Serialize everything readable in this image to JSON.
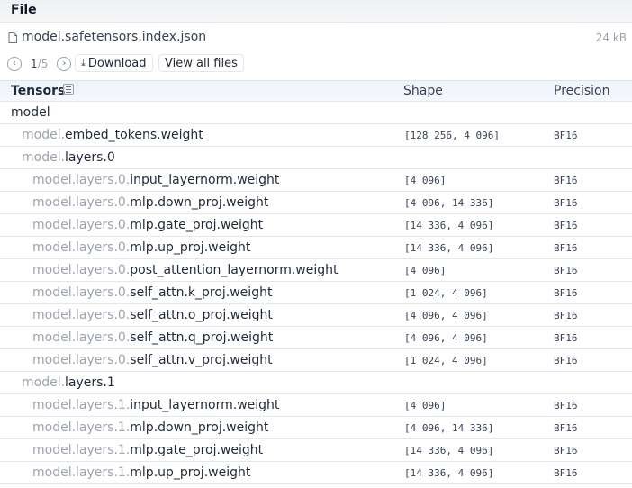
{
  "topbar": {
    "title": "File"
  },
  "file": {
    "name": "model.safetensors.index.json",
    "size": "24 kB",
    "page": "1",
    "page_sep": "/",
    "page_total": "5",
    "download_label": "Download",
    "view_all_label": "View all files"
  },
  "table": {
    "headers": {
      "tensors": "Tensors",
      "shape": "Shape",
      "precision": "Precision"
    },
    "rows": [
      {
        "kind": "group",
        "level": 0,
        "prefix": "",
        "suffix": "model"
      },
      {
        "kind": "tensor",
        "level": 1,
        "prefix": "model.",
        "suffix": "embed_tokens.weight",
        "shape": "[128 256, 4 096]",
        "precision": "BF16"
      },
      {
        "kind": "group",
        "level": 1,
        "prefix": "model.",
        "suffix": "layers.0"
      },
      {
        "kind": "tensor",
        "level": 2,
        "prefix": "model.layers.0.",
        "suffix": "input_layernorm.weight",
        "shape": "[4 096]",
        "precision": "BF16"
      },
      {
        "kind": "tensor",
        "level": 2,
        "prefix": "model.layers.0.",
        "suffix": "mlp.down_proj.weight",
        "shape": "[4 096, 14 336]",
        "precision": "BF16"
      },
      {
        "kind": "tensor",
        "level": 2,
        "prefix": "model.layers.0.",
        "suffix": "mlp.gate_proj.weight",
        "shape": "[14 336, 4 096]",
        "precision": "BF16"
      },
      {
        "kind": "tensor",
        "level": 2,
        "prefix": "model.layers.0.",
        "suffix": "mlp.up_proj.weight",
        "shape": "[14 336, 4 096]",
        "precision": "BF16"
      },
      {
        "kind": "tensor",
        "level": 2,
        "prefix": "model.layers.0.",
        "suffix": "post_attention_layernorm.weight",
        "shape": "[4 096]",
        "precision": "BF16"
      },
      {
        "kind": "tensor",
        "level": 2,
        "prefix": "model.layers.0.",
        "suffix": "self_attn.k_proj.weight",
        "shape": "[1 024, 4 096]",
        "precision": "BF16"
      },
      {
        "kind": "tensor",
        "level": 2,
        "prefix": "model.layers.0.",
        "suffix": "self_attn.o_proj.weight",
        "shape": "[4 096, 4 096]",
        "precision": "BF16"
      },
      {
        "kind": "tensor",
        "level": 2,
        "prefix": "model.layers.0.",
        "suffix": "self_attn.q_proj.weight",
        "shape": "[4 096, 4 096]",
        "precision": "BF16"
      },
      {
        "kind": "tensor",
        "level": 2,
        "prefix": "model.layers.0.",
        "suffix": "self_attn.v_proj.weight",
        "shape": "[1 024, 4 096]",
        "precision": "BF16"
      },
      {
        "kind": "group",
        "level": 1,
        "prefix": "model.",
        "suffix": "layers.1"
      },
      {
        "kind": "tensor",
        "level": 2,
        "prefix": "model.layers.1.",
        "suffix": "input_layernorm.weight",
        "shape": "[4 096]",
        "precision": "BF16"
      },
      {
        "kind": "tensor",
        "level": 2,
        "prefix": "model.layers.1.",
        "suffix": "mlp.down_proj.weight",
        "shape": "[4 096, 14 336]",
        "precision": "BF16"
      },
      {
        "kind": "tensor",
        "level": 2,
        "prefix": "model.layers.1.",
        "suffix": "mlp.gate_proj.weight",
        "shape": "[14 336, 4 096]",
        "precision": "BF16"
      },
      {
        "kind": "tensor",
        "level": 2,
        "prefix": "model.layers.1.",
        "suffix": "mlp.up_proj.weight",
        "shape": "[14 336, 4 096]",
        "precision": "BF16"
      }
    ]
  }
}
